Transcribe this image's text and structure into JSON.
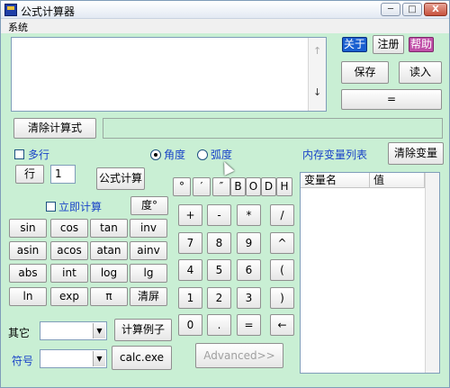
{
  "window": {
    "title": "公式计算器",
    "controls": [
      "─",
      "□",
      "X"
    ]
  },
  "menu": {
    "system": "系统"
  },
  "top_right": {
    "about": "关于",
    "register": "注册",
    "help": "帮助",
    "save": "保存",
    "load": "读入",
    "equals": "="
  },
  "colors": {
    "window_bg": "#c9efd4",
    "accent_blue": "#1a44c8",
    "about_bg": "#1a5fd0",
    "help_bg": "#c04fa8"
  },
  "formula": {
    "clear_formula": "清除计算式",
    "multiline": "多行",
    "row_button": "行",
    "row_value": "1",
    "calculate": "公式计算",
    "angle_unit": "角度",
    "radian_unit": "弧度",
    "immediate": "立即计算",
    "degree_button": "度°"
  },
  "memory": {
    "title": "内存变量列表",
    "clear": "清除变量",
    "col_name": "变量名",
    "col_value": "值"
  },
  "symbols": [
    "°",
    "′",
    "″",
    "B",
    "O",
    "D",
    "H"
  ],
  "functions": [
    [
      "sin",
      "cos",
      "tan",
      "inv"
    ],
    [
      "asin",
      "acos",
      "atan",
      "ainv"
    ],
    [
      "abs",
      "int",
      "log",
      "lg"
    ],
    [
      "ln",
      "exp",
      "π",
      "清屏"
    ]
  ],
  "keypad": [
    [
      "+",
      "-",
      "*",
      "/"
    ],
    [
      "7",
      "8",
      "9",
      "^"
    ],
    [
      "4",
      "5",
      "6",
      "("
    ],
    [
      "1",
      "2",
      "3",
      ")"
    ],
    [
      "0",
      ".",
      "=",
      "←"
    ]
  ],
  "bottom": {
    "other_label": "其它",
    "example_button": "计算例子",
    "symbol_label": "符号",
    "calc_exe": "calc.exe",
    "advanced": "Advanced>>"
  },
  "icons": {
    "scroll_up": "↑",
    "scroll_down": "↓",
    "combo_arrow": "▼"
  }
}
